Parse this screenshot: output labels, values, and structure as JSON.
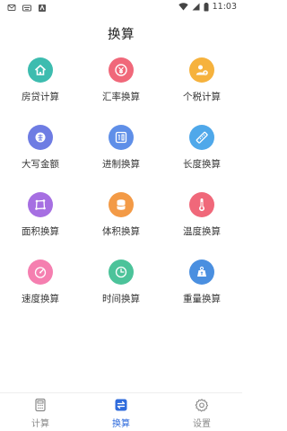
{
  "status_bar": {
    "time": "11:03"
  },
  "header": {
    "title": "换算"
  },
  "grid": {
    "items": [
      {
        "label": "房贷计算",
        "icon": "house-icon",
        "color": "#3dbcaf"
      },
      {
        "label": "汇率换算",
        "icon": "yen-icon",
        "color": "#f0687a"
      },
      {
        "label": "个税计算",
        "icon": "person-yen-icon",
        "color": "#f6b23d"
      },
      {
        "label": "大写金额",
        "icon": "capital-amount-icon",
        "color": "#6e7ce3"
      },
      {
        "label": "进制换算",
        "icon": "number-base-icon",
        "color": "#5f8fe8"
      },
      {
        "label": "长度换算",
        "icon": "ruler-icon",
        "color": "#4fa8ea"
      },
      {
        "label": "面积换算",
        "icon": "area-icon",
        "color": "#a66fe2"
      },
      {
        "label": "体积换算",
        "icon": "cylinder-icon",
        "color": "#f39a46"
      },
      {
        "label": "温度换算",
        "icon": "thermometer-icon",
        "color": "#f0687a"
      },
      {
        "label": "速度换算",
        "icon": "speedometer-icon",
        "color": "#f57fb0"
      },
      {
        "label": "时间换算",
        "icon": "clock-icon",
        "color": "#4cc39a"
      },
      {
        "label": "重量换算",
        "icon": "weight-icon",
        "color": "#4a8fe0"
      }
    ]
  },
  "tabbar": {
    "tabs": [
      {
        "label": "计算",
        "icon": "calculator-icon",
        "active": false
      },
      {
        "label": "换算",
        "icon": "swap-icon",
        "active": true
      },
      {
        "label": "设置",
        "icon": "gear-icon",
        "active": false
      }
    ]
  },
  "colors": {
    "accent": "#2f6bdc",
    "inactive": "#888888"
  }
}
